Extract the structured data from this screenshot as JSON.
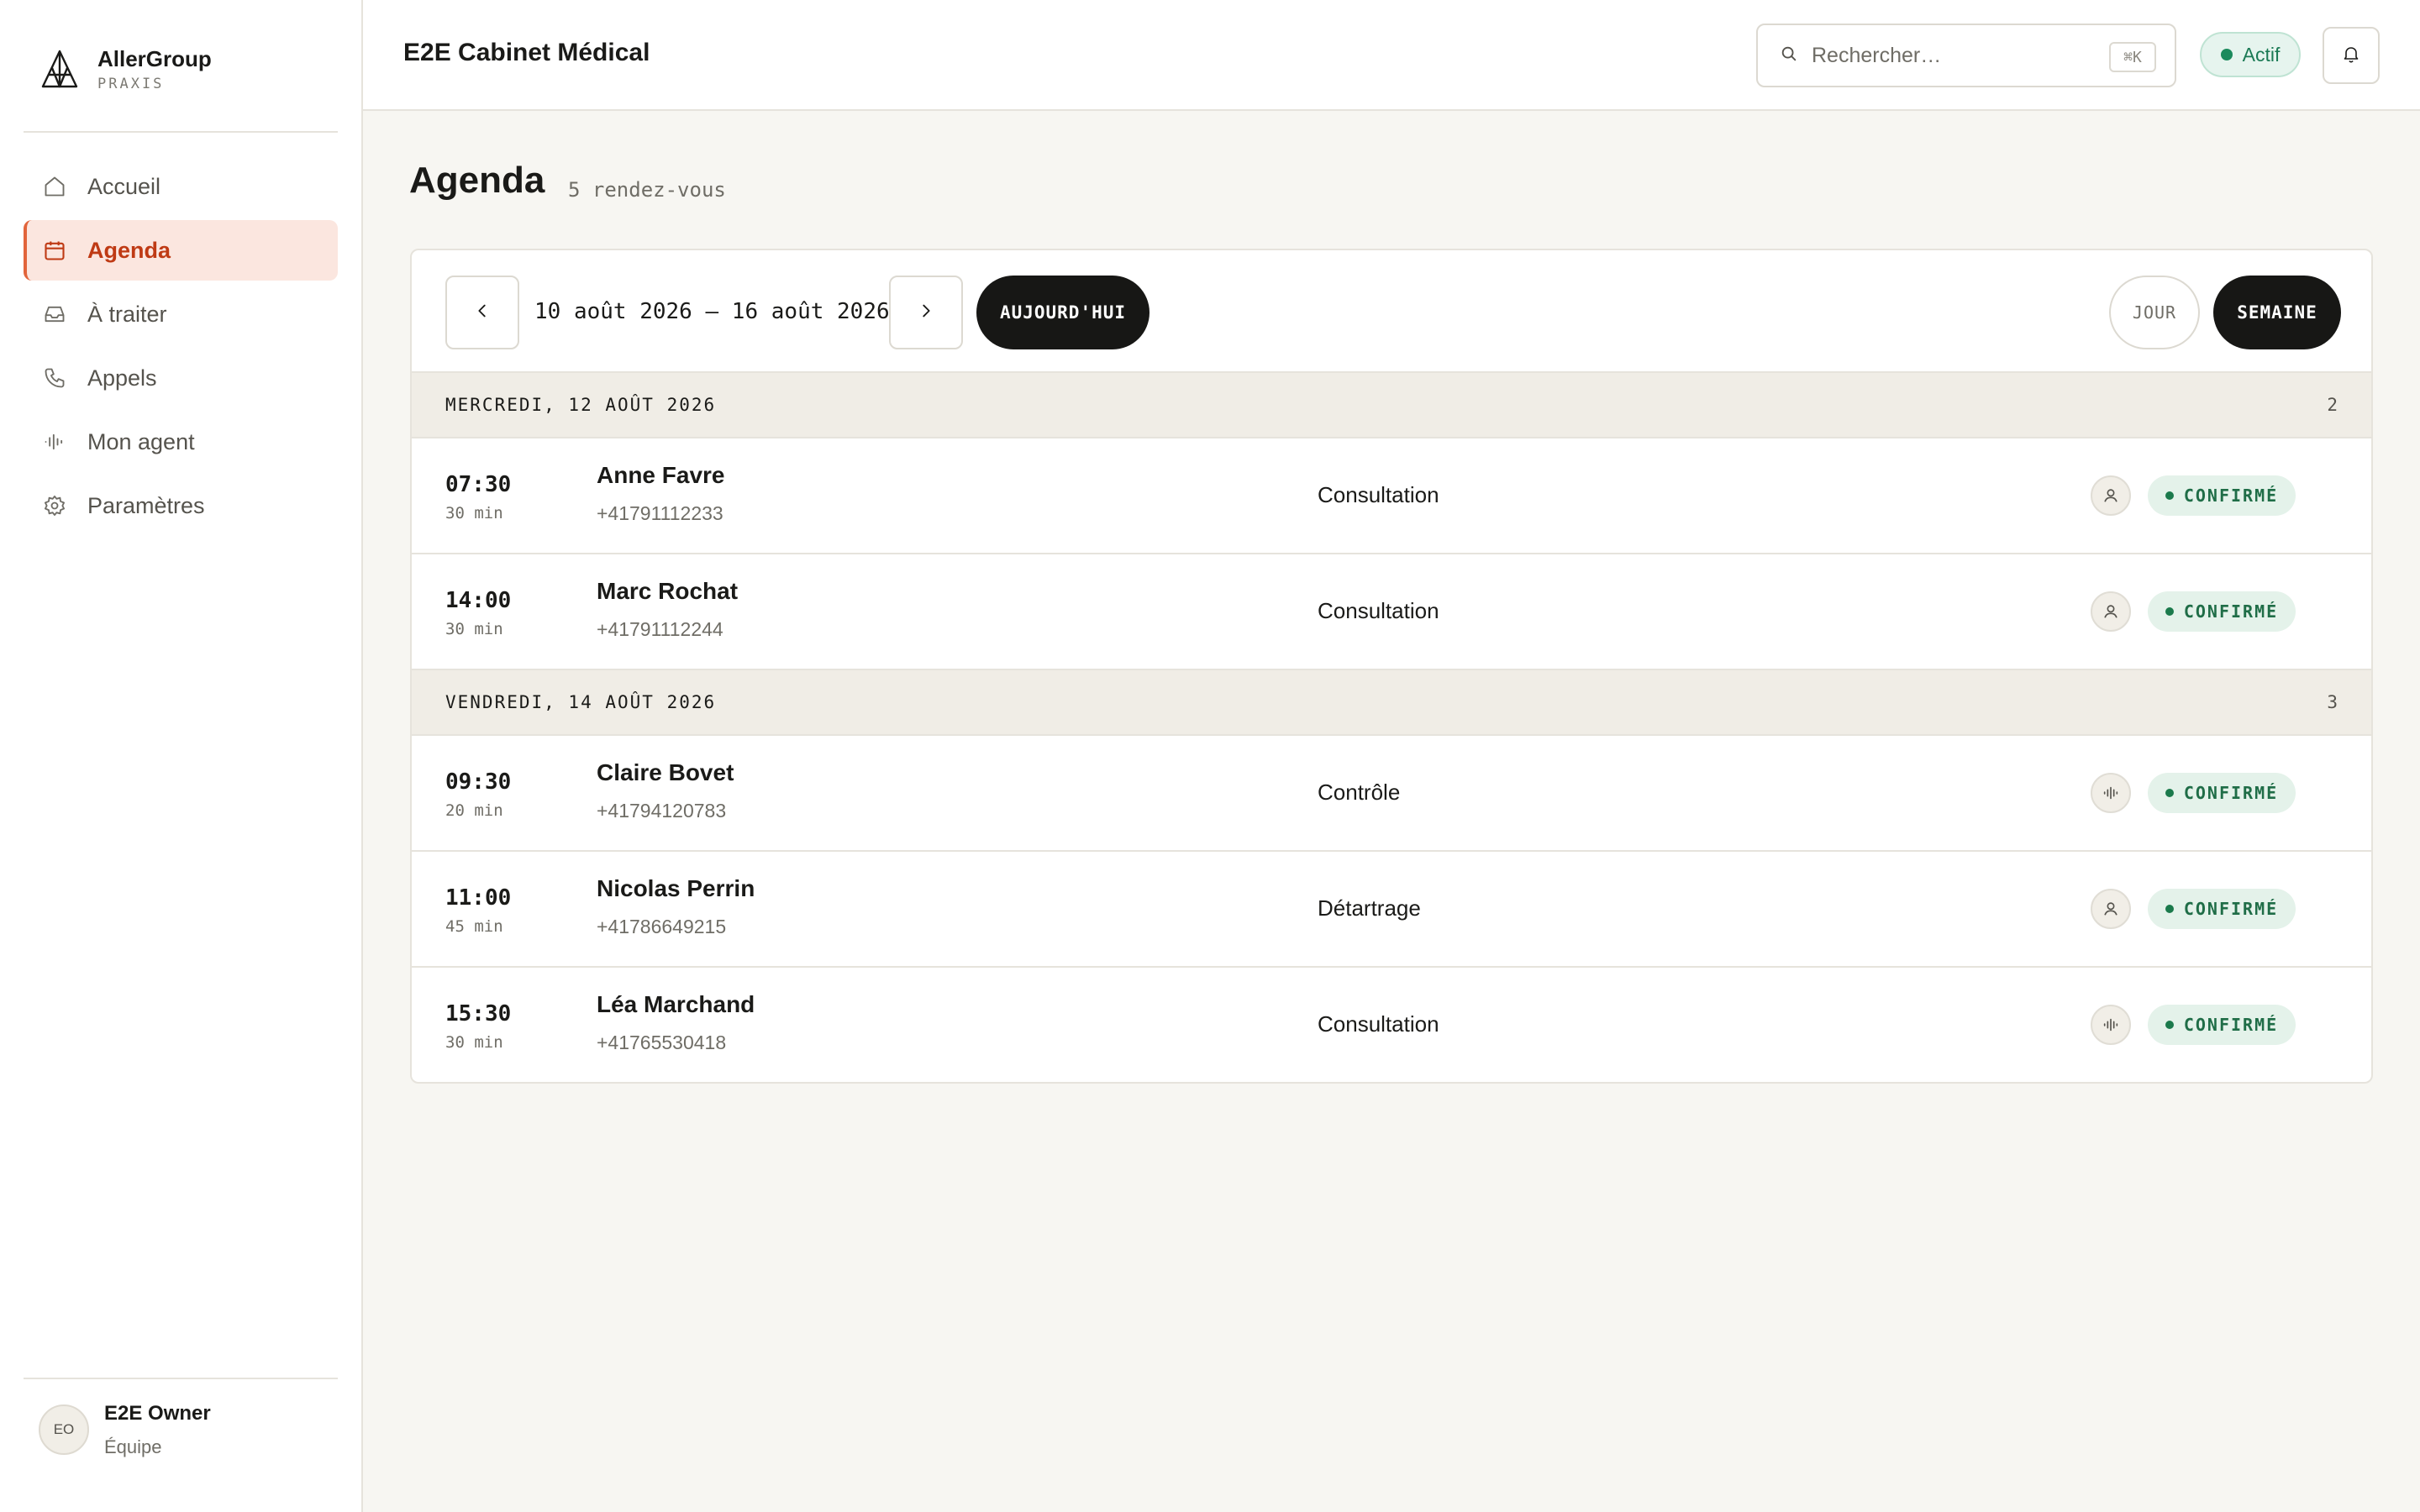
{
  "brand": {
    "name": "AllerGroup",
    "subtitle": "PRAXIS"
  },
  "sidebar": {
    "items": [
      {
        "label": "Accueil",
        "icon": "home-icon",
        "active": false
      },
      {
        "label": "Agenda",
        "icon": "calendar-icon",
        "active": true
      },
      {
        "label": "À traiter",
        "icon": "inbox-icon",
        "active": false
      },
      {
        "label": "Appels",
        "icon": "phone-icon",
        "active": false
      },
      {
        "label": "Mon agent",
        "icon": "waveform-icon",
        "active": false
      },
      {
        "label": "Paramètres",
        "icon": "gear-icon",
        "active": false
      }
    ]
  },
  "user": {
    "initials": "EO",
    "name": "E2E Owner",
    "role": "Équipe"
  },
  "header": {
    "workspace": "E2E Cabinet Médical",
    "search_placeholder": "Rechercher…",
    "search_shortcut": "⌘K",
    "status": "Actif"
  },
  "page": {
    "title": "Agenda",
    "count": "5 rendez-vous"
  },
  "toolbar": {
    "range": "10 août 2026 – 16 août 2026",
    "today_label": "AUJOURD'HUI",
    "view_day_label": "JOUR",
    "view_week_label": "SEMAINE"
  },
  "days": [
    {
      "label": "MERCREDI, 12 AOÛT 2026",
      "count": "2",
      "appointments": [
        {
          "time": "07:30",
          "duration": "30 min",
          "name": "Anne Favre",
          "phone": "+41791112233",
          "type": "Consultation",
          "source": "person-icon",
          "status": "CONFIRMÉ"
        },
        {
          "time": "14:00",
          "duration": "30 min",
          "name": "Marc Rochat",
          "phone": "+41791112244",
          "type": "Consultation",
          "source": "person-icon",
          "status": "CONFIRMÉ"
        }
      ]
    },
    {
      "label": "VENDREDI, 14 AOÛT 2026",
      "count": "3",
      "appointments": [
        {
          "time": "09:30",
          "duration": "20 min",
          "name": "Claire Bovet",
          "phone": "+41794120783",
          "type": "Contrôle",
          "source": "waveform-icon",
          "status": "CONFIRMÉ"
        },
        {
          "time": "11:00",
          "duration": "45 min",
          "name": "Nicolas Perrin",
          "phone": "+41786649215",
          "type": "Détartrage",
          "source": "person-icon",
          "status": "CONFIRMÉ"
        },
        {
          "time": "15:30",
          "duration": "30 min",
          "name": "Léa Marchand",
          "phone": "+41765530418",
          "type": "Consultation",
          "source": "waveform-icon",
          "status": "CONFIRMÉ"
        }
      ]
    }
  ],
  "colors": {
    "accent": "#e2643b",
    "accent_text": "#bf3a14",
    "status_green": "#1b8a5c",
    "dark_button": "#171715"
  }
}
